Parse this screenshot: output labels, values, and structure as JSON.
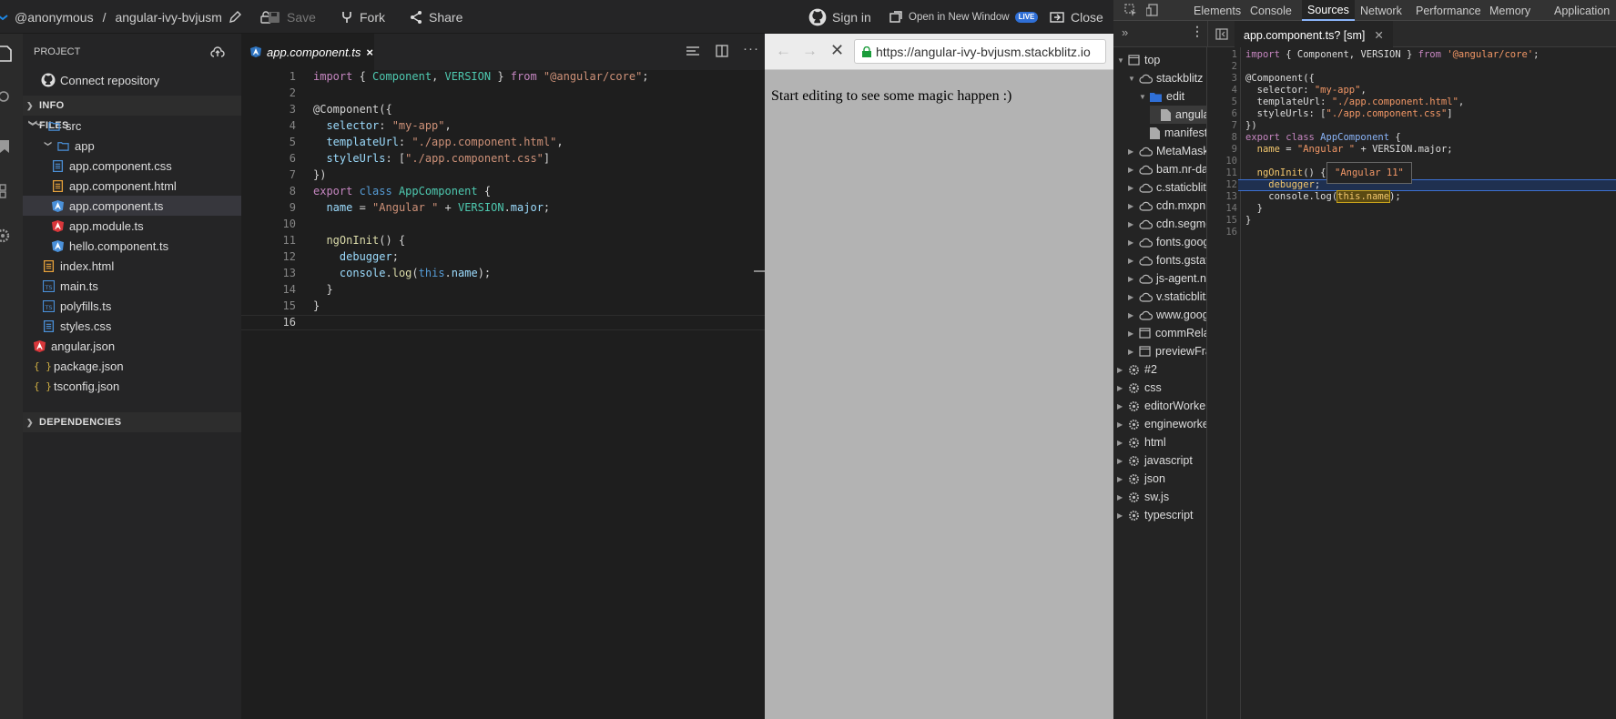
{
  "topbar": {
    "user": "@anonymous",
    "separator": "/",
    "project": "angular-ivy-bvjusm",
    "save": "Save",
    "fork": "Fork",
    "share": "Share",
    "sign_in": "Sign in",
    "open_new_window": "Open in New Window",
    "live": "LIVE",
    "close": "Close"
  },
  "sidebar": {
    "project_header": "PROJECT",
    "connect_repo": "Connect repository",
    "info": "INFO",
    "files": "FILES",
    "dependencies": "DEPENDENCIES",
    "tree": [
      {
        "name": "src",
        "kind": "folder"
      },
      {
        "name": "app",
        "kind": "folder"
      },
      {
        "name": "app.component.css",
        "kind": "css"
      },
      {
        "name": "app.component.html",
        "kind": "html"
      },
      {
        "name": "app.component.ts",
        "kind": "angular"
      },
      {
        "name": "app.module.ts",
        "kind": "angular-red"
      },
      {
        "name": "hello.component.ts",
        "kind": "angular"
      },
      {
        "name": "index.html",
        "kind": "html"
      },
      {
        "name": "main.ts",
        "kind": "ts"
      },
      {
        "name": "polyfills.ts",
        "kind": "ts"
      },
      {
        "name": "styles.css",
        "kind": "css"
      },
      {
        "name": "angular.json",
        "kind": "angular-red"
      },
      {
        "name": "package.json",
        "kind": "json"
      },
      {
        "name": "tsconfig.json",
        "kind": "json"
      }
    ]
  },
  "editor": {
    "tab": "app.component.ts",
    "tab_close": "×",
    "line_numbers": [
      "1",
      "2",
      "3",
      "4",
      "5",
      "6",
      "7",
      "8",
      "9",
      "10",
      "11",
      "12",
      "13",
      "14",
      "15",
      "16"
    ],
    "code": {
      "l1_kw": "import",
      "l1_a": " { ",
      "l1_t1": "Component",
      "l1_b": ", ",
      "l1_t2": "VERSION",
      "l1_c": " } ",
      "l1_kw2": "from",
      "l1_s": " \"@angular/core\"",
      "l1_d": ";",
      "l3": "@Component({",
      "l4_p": "  selector",
      "l4_a": ": ",
      "l4_s": "\"my-app\"",
      "l4_b": ",",
      "l5_p": "  templateUrl",
      "l5_a": ": ",
      "l5_s": "\"./app.component.html\"",
      "l5_b": ",",
      "l6_p": "  styleUrls",
      "l6_a": ": [",
      "l6_s": "\"./app.component.css\"",
      "l6_b": "]",
      "l7": "})",
      "l8_kw": "export",
      "l8_kw2": " class ",
      "l8_t": "AppComponent",
      "l8_a": " {",
      "l9_p": "  name",
      "l9_a": " = ",
      "l9_s": "\"Angular \"",
      "l9_b": " + ",
      "l9_c": "VERSION",
      "l9_d": ".",
      "l9_e": "major",
      "l9_f": ";",
      "l11_f": "  ngOnInit",
      "l11_a": "() {",
      "l12_k": "    debugger",
      "l12_a": ";",
      "l13_a": "    console",
      "l13_b": ".",
      "l13_f": "log",
      "l13_c": "(",
      "l13_k": "this",
      "l13_d": ".",
      "l13_e": "name",
      "l13_g": ");",
      "l14": "  }",
      "l15": "}"
    }
  },
  "preview": {
    "url": "https://angular-ivy-bvjusm.stackblitz.io",
    "content": "Start editing to see some magic happen :)"
  },
  "devtools": {
    "tabs": [
      "Elements",
      "Console",
      "Sources",
      "Network",
      "Performance",
      "Memory",
      "Application"
    ],
    "active_tab": "Sources",
    "file_tab": "app.component.ts? [sm]",
    "tree": [
      {
        "name": "top",
        "indent": 0,
        "kind": "frame",
        "arrow": "▼"
      },
      {
        "name": "stackblitz",
        "indent": 1,
        "kind": "cloud",
        "arrow": "▼"
      },
      {
        "name": "edit",
        "indent": 2,
        "kind": "folder",
        "arrow": "▼"
      },
      {
        "name": "angular",
        "indent": 3,
        "kind": "file",
        "arrow": ""
      },
      {
        "name": "manifest",
        "indent": 2,
        "kind": "file",
        "arrow": ""
      },
      {
        "name": "MetaMask",
        "indent": 1,
        "kind": "cloud",
        "arrow": "▶"
      },
      {
        "name": "bam.nr-data",
        "indent": 1,
        "kind": "cloud",
        "arrow": "▶"
      },
      {
        "name": "c.staticblitz",
        "indent": 1,
        "kind": "cloud",
        "arrow": "▶"
      },
      {
        "name": "cdn.mxpnl",
        "indent": 1,
        "kind": "cloud",
        "arrow": "▶"
      },
      {
        "name": "cdn.segment",
        "indent": 1,
        "kind": "cloud",
        "arrow": "▶"
      },
      {
        "name": "fonts.google",
        "indent": 1,
        "kind": "cloud",
        "arrow": "▶"
      },
      {
        "name": "fonts.gstatic",
        "indent": 1,
        "kind": "cloud",
        "arrow": "▶"
      },
      {
        "name": "js-agent.n",
        "indent": 1,
        "kind": "cloud",
        "arrow": "▶"
      },
      {
        "name": "v.staticblitz",
        "indent": 1,
        "kind": "cloud",
        "arrow": "▶"
      },
      {
        "name": "www.google",
        "indent": 1,
        "kind": "cloud",
        "arrow": "▶"
      },
      {
        "name": "commRelay",
        "indent": 1,
        "kind": "frame",
        "arrow": "▶"
      },
      {
        "name": "previewFrame",
        "indent": 1,
        "kind": "frame",
        "arrow": "▶"
      },
      {
        "name": "#2",
        "indent": 0,
        "kind": "gear",
        "arrow": "▶"
      },
      {
        "name": "css",
        "indent": 0,
        "kind": "gear",
        "arrow": "▶"
      },
      {
        "name": "editorWorker",
        "indent": 0,
        "kind": "gear",
        "arrow": "▶"
      },
      {
        "name": "engineworker",
        "indent": 0,
        "kind": "gear",
        "arrow": "▶"
      },
      {
        "name": "html",
        "indent": 0,
        "kind": "gear",
        "arrow": "▶"
      },
      {
        "name": "javascript",
        "indent": 0,
        "kind": "gear",
        "arrow": "▶"
      },
      {
        "name": "json",
        "indent": 0,
        "kind": "gear",
        "arrow": "▶"
      },
      {
        "name": "sw.js",
        "indent": 0,
        "kind": "gear",
        "arrow": "▶"
      },
      {
        "name": "typescript",
        "indent": 0,
        "kind": "gear",
        "arrow": "▶"
      }
    ],
    "line_numbers": [
      "1",
      "2",
      "3",
      "4",
      "5",
      "6",
      "7",
      "8",
      "9",
      "10",
      "11",
      "12",
      "13",
      "14",
      "15",
      "16"
    ],
    "code": {
      "l1_kw": "import",
      "l1_a": " { Component, VERSION } ",
      "l1_kw2": "from",
      "l1_s": " '@angular/core'",
      "l1_b": ";",
      "l3": "@Component({",
      "l4_a": "  selector: ",
      "l4_s": "\"my-app\"",
      "l4_b": ",",
      "l5_a": "  templateUrl: ",
      "l5_s": "\"./app.component.html\"",
      "l5_b": ",",
      "l6_a": "  styleUrls: [",
      "l6_s": "\"./app.component.css\"",
      "l6_b": "]",
      "l7": "})",
      "l8_kw": "export class",
      "l8_t": " AppComponent",
      "l8_a": " {",
      "l9_p": "  name",
      "l9_a": " = ",
      "l9_s": "\"Angular \"",
      "l9_b": " + VERSION.major;",
      "l11_p": "  ngOnInit",
      "l11_a": "() {",
      "l12_k": "    debugger",
      "l12_a": ";",
      "l13_a": "    console.log(",
      "l13_h": "this.name",
      "l13_b": ");",
      "l14": "  }",
      "l15": "}"
    },
    "tooltip": "\"Angular 11\""
  }
}
